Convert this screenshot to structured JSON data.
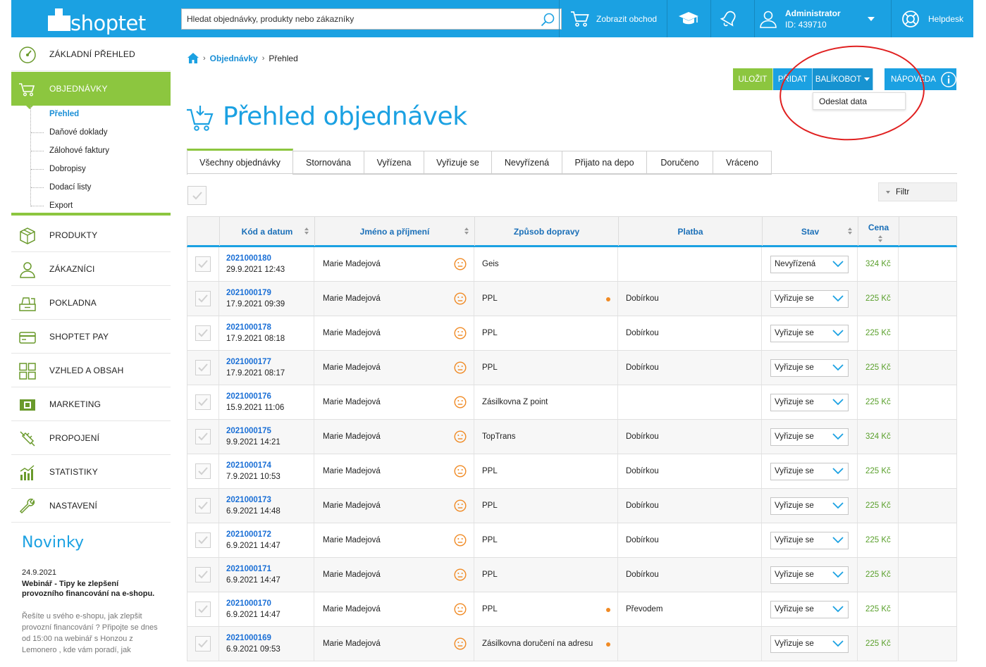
{
  "app": {
    "logo_text": "shoptet"
  },
  "topbar": {
    "search_placeholder": "Hledat objednávky, produkty nebo zákazníky",
    "show_shop": "Zobrazit obchod",
    "admin_name": "Administrator",
    "admin_id": "ID: 439710",
    "helpdesk": "Helpdesk"
  },
  "sidebar": {
    "items": [
      {
        "label": "ZÁKLADNÍ PŘEHLED",
        "icon": "dashboard-gauge-icon"
      },
      {
        "label": "OBJEDNÁVKY",
        "icon": "cart-icon",
        "active": true
      },
      {
        "label": "PRODUKTY",
        "icon": "box-icon"
      },
      {
        "label": "ZÁKAZNÍCI",
        "icon": "user-icon"
      },
      {
        "label": "POKLADNA",
        "icon": "cash-register-icon"
      },
      {
        "label": "SHOPTET PAY",
        "icon": "card-icon"
      },
      {
        "label": "VZHLED A OBSAH",
        "icon": "layout-grid-icon"
      },
      {
        "label": "MARKETING",
        "icon": "megaphone-icon"
      },
      {
        "label": "PROPOJENÍ",
        "icon": "plug-icon"
      },
      {
        "label": "STATISTIKY",
        "icon": "bar-stats-icon"
      },
      {
        "label": "NASTAVENÍ",
        "icon": "wrench-icon"
      }
    ],
    "sub": [
      "Přehled",
      "Daňové doklady",
      "Zálohové faktury",
      "Dobropisy",
      "Dodací listy",
      "Export"
    ]
  },
  "news": {
    "title": "Novinky",
    "date": "24.9.2021",
    "headline": "Webinář - Tipy ke zlepšení provozního financování na e-shopu.",
    "text": "Řešíte u svého e-shopu, jak zlepšit provozní financování ? Připojte se dnes od 15:00 na webinář s Honzou z Lemonero , kde vám poradí, jak"
  },
  "breadcrumb": {
    "orders": "Objednávky",
    "current": "Přehled",
    "sep": "›"
  },
  "actions": {
    "save": "ULOŽIT",
    "add": "PŘIDAT",
    "balikobot": "BALÍKOBOT",
    "help": "NÁPOVĚDA",
    "dropdown_item": "Odeslat data"
  },
  "page_title": "Přehled objednávek",
  "tabs": [
    "Všechny objednávky",
    "Stornována",
    "Vyřízena",
    "Vyřizuje se",
    "Nevyřízená",
    "Přijato na depo",
    "Doručeno",
    "Vráceno"
  ],
  "filter": "Filtr",
  "table": {
    "headers": {
      "code": "Kód a datum",
      "name": "Jméno a příjmení",
      "shipping": "Způsob dopravy",
      "payment": "Platba",
      "status": "Stav",
      "price": "Cena"
    },
    "rows": [
      {
        "code": "2021000180",
        "date": "29.9.2021 12:43",
        "name": "Marie Madejová",
        "shipping": "Geis",
        "dot": false,
        "payment": "",
        "status": "Nevyřízená",
        "price": "324 Kč"
      },
      {
        "code": "2021000179",
        "date": "17.9.2021 09:39",
        "name": "Marie Madejová",
        "shipping": "PPL",
        "dot": true,
        "payment": "Dobírkou",
        "status": "Vyřizuje se",
        "price": "225 Kč"
      },
      {
        "code": "2021000178",
        "date": "17.9.2021 08:18",
        "name": "Marie Madejová",
        "shipping": "PPL",
        "dot": false,
        "payment": "Dobírkou",
        "status": "Vyřizuje se",
        "price": "225 Kč"
      },
      {
        "code": "2021000177",
        "date": "17.9.2021 08:17",
        "name": "Marie Madejová",
        "shipping": "PPL",
        "dot": false,
        "payment": "Dobírkou",
        "status": "Vyřizuje se",
        "price": "225 Kč"
      },
      {
        "code": "2021000176",
        "date": "15.9.2021 11:06",
        "name": "Marie Madejová",
        "shipping": "Zásilkovna Z point",
        "dot": false,
        "payment": "",
        "status": "Vyřizuje se",
        "price": "225 Kč"
      },
      {
        "code": "2021000175",
        "date": "9.9.2021 14:21",
        "name": "Marie Madejová",
        "shipping": "TopTrans",
        "dot": false,
        "payment": "Dobírkou",
        "status": "Vyřizuje se",
        "price": "324 Kč"
      },
      {
        "code": "2021000174",
        "date": "7.9.2021 10:53",
        "name": "Marie Madejová",
        "shipping": "PPL",
        "dot": false,
        "payment": "Dobírkou",
        "status": "Vyřizuje se",
        "price": "225 Kč"
      },
      {
        "code": "2021000173",
        "date": "6.9.2021 14:48",
        "name": "Marie Madejová",
        "shipping": "PPL",
        "dot": false,
        "payment": "Dobírkou",
        "status": "Vyřizuje se",
        "price": "225 Kč"
      },
      {
        "code": "2021000172",
        "date": "6.9.2021 14:47",
        "name": "Marie Madejová",
        "shipping": "PPL",
        "dot": false,
        "payment": "Dobírkou",
        "status": "Vyřizuje se",
        "price": "225 Kč"
      },
      {
        "code": "2021000171",
        "date": "6.9.2021 14:47",
        "name": "Marie Madejová",
        "shipping": "PPL",
        "dot": false,
        "payment": "Dobírkou",
        "status": "Vyřizuje se",
        "price": "225 Kč"
      },
      {
        "code": "2021000170",
        "date": "6.9.2021 14:47",
        "name": "Marie Madejová",
        "shipping": "PPL",
        "dot": true,
        "payment": "Převodem",
        "status": "Vyřizuje se",
        "price": "225 Kč"
      },
      {
        "code": "2021000169",
        "date": "6.9.2021 09:53",
        "name": "Marie Madejová",
        "shipping": "Zásilkovna doručení na adresu",
        "dot": true,
        "payment": "",
        "status": "Vyřizuje se",
        "price": "225 Kč"
      }
    ]
  },
  "colors": {
    "brand_blue": "#1ba1e2",
    "brand_green": "#8cc63f",
    "price_green": "#5aa02c",
    "annotation_red": "#e02020",
    "dot_orange": "#f08a24"
  }
}
